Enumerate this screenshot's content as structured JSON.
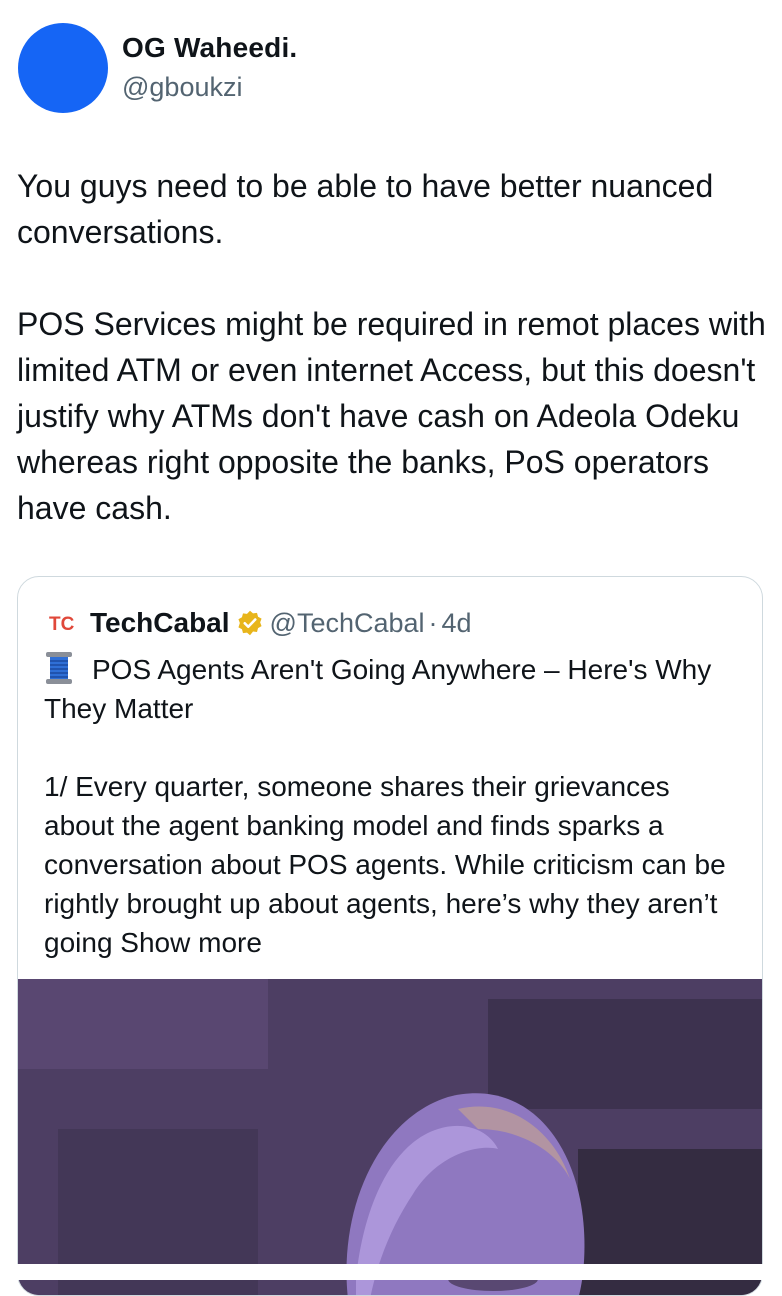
{
  "tweet": {
    "author": {
      "name": "OG Waheedi.",
      "handle": "@gboukzi"
    },
    "paragraphs": [
      "You guys need to be able to have better nuanced conversations.",
      "POS Services might be required in remot places with limited ATM or even internet Access, but this doesn't justify why ATMs don't have cash on Adeola Odeku whereas right opposite the banks, PoS operators have cash."
    ]
  },
  "quote": {
    "name": "TechCabal",
    "logo_text": "TC",
    "handle": "@TechCabal",
    "separator": "·",
    "time": "4d",
    "title": "POS Agents Aren't Going Anywhere – Here's Why They Matter",
    "body": "1/ Every quarter, someone shares their grievances about the agent banking model and finds sparks a conversation about POS agents. While criticism can be rightly brought up about agents, here’s why they aren’t going",
    "show_more": "Show more"
  },
  "colors": {
    "avatar": "#1565f5",
    "verified_badge": "#e8b51b",
    "logo": "#e0483a",
    "secondary_text": "#536471"
  },
  "icons": [
    "verified-badge-icon",
    "spool-of-thread-icon",
    "techcabal-logo"
  ]
}
